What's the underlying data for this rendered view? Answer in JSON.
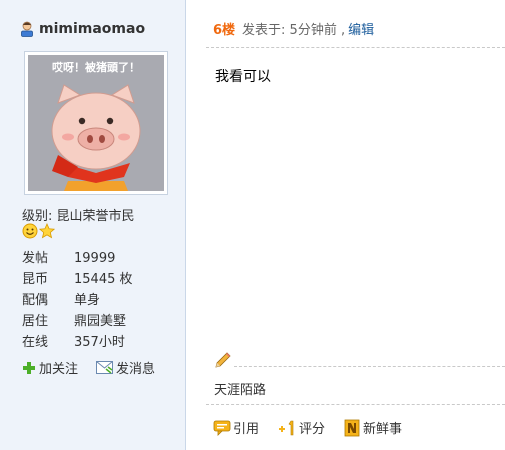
{
  "user": {
    "name": "mimimaomao",
    "avatar_caption": "哎呀！被猪頭了！",
    "level_label": "级别:",
    "level_value": "昆山荣誉市民",
    "stats": [
      {
        "label": "发帖",
        "value": "19999"
      },
      {
        "label": "昆币",
        "value": "15445 枚"
      },
      {
        "label": "配偶",
        "value": "单身"
      },
      {
        "label": "居住",
        "value": "鼎园美墅"
      },
      {
        "label": "在线",
        "value": "357小时"
      }
    ],
    "actions": {
      "follow": "加关注",
      "message": "发消息"
    }
  },
  "post": {
    "floor": "6楼",
    "posted_prefix": "发表于: 5分钟前 ,",
    "edit": "编辑",
    "content": "我看可以",
    "signature": "天涯陌路"
  },
  "toolbar": {
    "quote": "引用",
    "rate": "评分",
    "news": "新鲜事"
  },
  "colors": {
    "sidebar_bg": "#eef3fa",
    "floor": "#f0690f",
    "link": "#1d5d9c"
  },
  "icons": [
    "user-icon",
    "smiley-icon",
    "star-icon",
    "plus-icon",
    "envelope-icon",
    "pencil-icon",
    "quote-icon",
    "rate-icon",
    "news-icon"
  ]
}
